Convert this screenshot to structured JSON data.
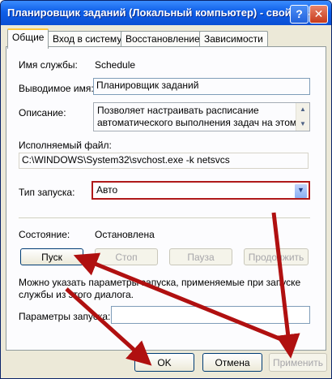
{
  "window": {
    "title": "Планировщик заданий (Локальный компьютер) - свойства",
    "help_glyph": "?",
    "close_glyph": "✕"
  },
  "tabs": [
    {
      "label": "Общие"
    },
    {
      "label": "Вход в систему"
    },
    {
      "label": "Восстановление"
    },
    {
      "label": "Зависимости"
    }
  ],
  "general": {
    "service_name_label": "Имя службы:",
    "service_name_value": "Schedule",
    "display_name_label": "Выводимое имя:",
    "display_name_value": "Планировщик заданий",
    "description_label": "Описание:",
    "description_line1": "Позволяет настраивать расписание",
    "description_line2": "автоматического выполнения задач на этом",
    "exe_label": "Исполняемый файл:",
    "exe_value": "C:\\WINDOWS\\System32\\svchost.exe -k netsvcs",
    "startup_type_label": "Тип запуска:",
    "startup_type_value": "Авто",
    "status_label": "Состояние:",
    "status_value": "Остановлена",
    "hint_line1": "Можно указать параметры запуска, применяемые при запуске",
    "hint_line2": "службы из этого диалога.",
    "params_label": "Параметры запуска:",
    "params_value": ""
  },
  "service_buttons": {
    "start": "Пуск",
    "stop": "Стоп",
    "pause": "Пауза",
    "resume": "Продолжить"
  },
  "footer": {
    "ok": "OK",
    "cancel": "Отмена",
    "apply": "Применить"
  },
  "colors": {
    "annotation_arrow": "#b01010",
    "titlebar": "#0f5fe8"
  }
}
